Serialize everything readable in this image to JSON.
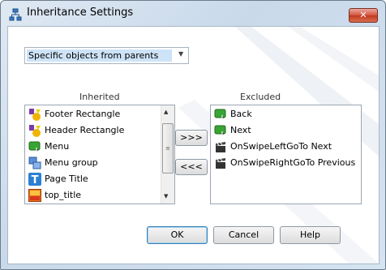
{
  "window": {
    "title": "Inheritance Settings",
    "close_label": "✕"
  },
  "scope_combo": {
    "value": "Specific objects from parents"
  },
  "inherited": {
    "label": "Inherited",
    "items": [
      {
        "label": "Footer Rectangle",
        "icon": "shapes-icon"
      },
      {
        "label": "Header Rectangle",
        "icon": "shapes-icon"
      },
      {
        "label": "Menu",
        "icon": "button-icon"
      },
      {
        "label": "Menu group",
        "icon": "group-icon"
      },
      {
        "label": "Page Title",
        "icon": "text-icon"
      },
      {
        "label": "top_title",
        "icon": "image-icon"
      }
    ]
  },
  "excluded": {
    "label": "Excluded",
    "items": [
      {
        "label": "Back",
        "icon": "button-icon"
      },
      {
        "label": "Next",
        "icon": "button-icon"
      },
      {
        "label": "OnSwipeLeftGoTo Next",
        "icon": "clapper-icon"
      },
      {
        "label": "OnSwipeRightGoTo Previous",
        "icon": "clapper-icon"
      }
    ]
  },
  "move_buttons": {
    "to_excluded": ">>>",
    "to_inherited": "<<<"
  },
  "footer": {
    "ok": "OK",
    "cancel": "Cancel",
    "help": "Help"
  }
}
